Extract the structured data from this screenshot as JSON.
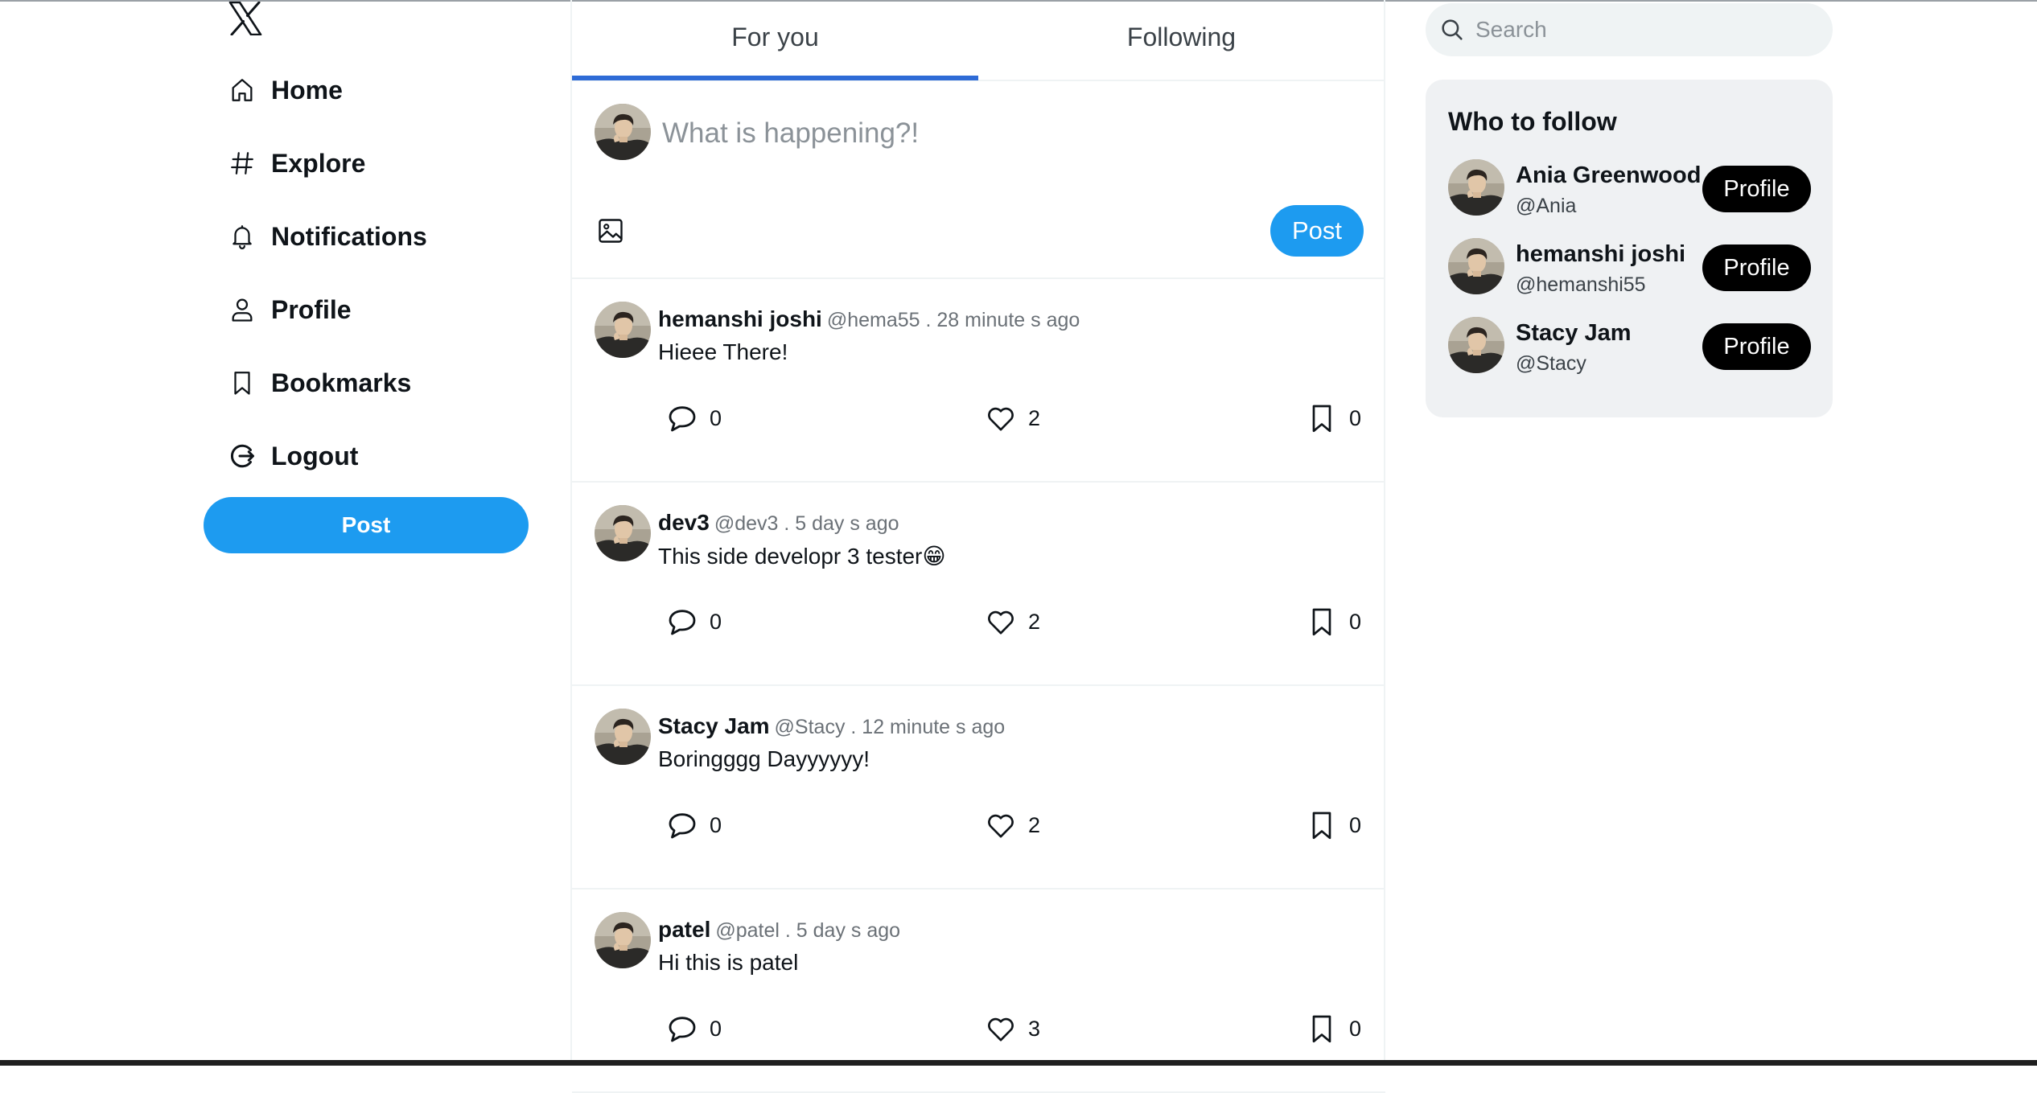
{
  "nav": {
    "items": [
      {
        "label": "Home",
        "icon": "home-icon"
      },
      {
        "label": "Explore",
        "icon": "hashtag-icon"
      },
      {
        "label": "Notifications",
        "icon": "bell-icon"
      },
      {
        "label": "Profile",
        "icon": "user-icon"
      },
      {
        "label": "Bookmarks",
        "icon": "bookmark-icon"
      },
      {
        "label": "Logout",
        "icon": "logout-icon"
      }
    ],
    "post_label": "Post"
  },
  "tabs": [
    {
      "label": "For you",
      "active": true
    },
    {
      "label": "Following",
      "active": false
    }
  ],
  "composer": {
    "placeholder": "What is happening?!",
    "post_label": "Post"
  },
  "posts": [
    {
      "name": "hemanshi joshi",
      "meta": "@hema55 . 28 minute s ago",
      "text": "Hieee There!",
      "comments": "0",
      "likes": "2",
      "bookmarks": "0"
    },
    {
      "name": "dev3",
      "meta": "@dev3 . 5 day s ago",
      "text": "This side developr 3 tester😁",
      "comments": "0",
      "likes": "2",
      "bookmarks": "0"
    },
    {
      "name": "Stacy Jam",
      "meta": "@Stacy . 12 minute s ago",
      "text": "Boringggg Dayyyyyy!",
      "comments": "0",
      "likes": "2",
      "bookmarks": "0"
    },
    {
      "name": "patel",
      "meta": "@patel . 5 day s ago",
      "text": "Hi this is patel",
      "comments": "0",
      "likes": "3",
      "bookmarks": "0"
    }
  ],
  "search": {
    "placeholder": "Search"
  },
  "who_to_follow": {
    "title": "Who to follow",
    "users": [
      {
        "name": "Ania Greenwood",
        "handle": "@Ania",
        "button": "Profile"
      },
      {
        "name": "hemanshi joshi",
        "handle": "@hemanshi55",
        "button": "Profile"
      },
      {
        "name": "Stacy Jam",
        "handle": "@Stacy",
        "button": "Profile"
      }
    ]
  },
  "colors": {
    "accent": "#1d9bf0",
    "tab_indicator": "#2e6bd6",
    "follow_button": "#000000"
  }
}
